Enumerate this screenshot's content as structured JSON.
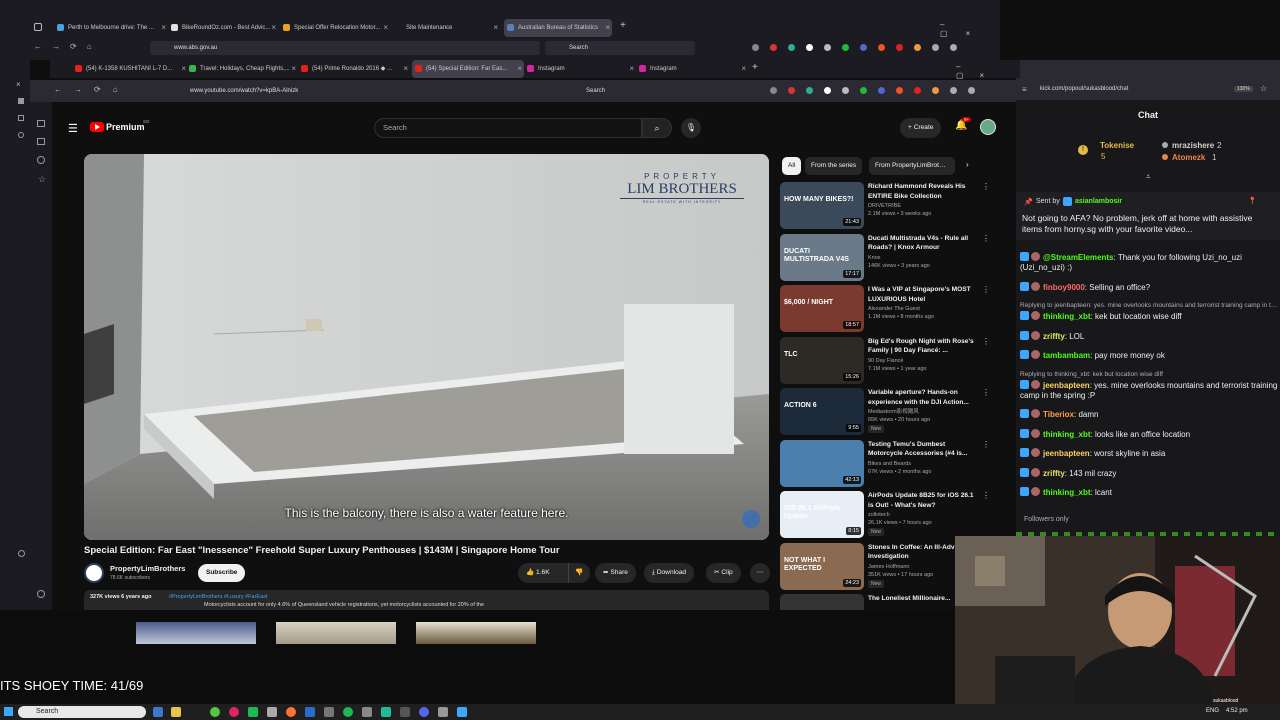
{
  "back_browser": {
    "tabs": [
      {
        "label": "Perth to Melbourne drive: The ...",
        "color": "#4aa3df"
      },
      {
        "label": "BikeRoundOz.com - Best Advic...",
        "color": "#e0e0e0"
      },
      {
        "label": "Special Offer Relocation Motor...",
        "color": "#e8a21c"
      },
      {
        "label": "Site Maintenance",
        "color": "#888888"
      },
      {
        "label": "Australian Bureau of Statistics",
        "color": "#5b7fb8"
      }
    ],
    "url": "www.abs.gov.au",
    "search_placeholder": "Search"
  },
  "front_browser": {
    "tabs": [
      {
        "label": "(54) K-1358 KUSHITANI L-7 D...",
        "color": "#e62117"
      },
      {
        "label": "Travel: Holidays, Cheap Flights,...",
        "color": "#3bb34a"
      },
      {
        "label": "(54) Prime Ronaldo 2016 ◆ ...",
        "color": "#e62117"
      },
      {
        "label": "(54) Special Edition: Far Eas...",
        "color": "#e62117"
      },
      {
        "label": "Instagram",
        "color": "#d6249f"
      },
      {
        "label": "Instagram",
        "color": "#d6249f"
      }
    ],
    "url": "www.youtube.com/watch?v=kpBA-Alnizk",
    "search_placeholder": "Search"
  },
  "youtube": {
    "logo": "Premium",
    "logo_region": "SG",
    "search_placeholder": "Search",
    "create_label": "Create",
    "notifications_count": "9+",
    "video": {
      "brand_line1": "PROPERTY",
      "brand_line2": "LIM BROTHERS",
      "brand_line3": "REAL ESTATE WITH INTEGRITY",
      "caption": "This is the balcony, there is also a water feature here.",
      "title": "Special Edition: Far East \"Inessence\" Freehold Super Luxury Penthouses | $143M | Singapore Home Tour",
      "channel": "PropertyLimBrothers",
      "subscribers": "78.6K subscribers",
      "subscribe_label": "Subscribe",
      "likes": "1.6K",
      "share_label": "Share",
      "download_label": "Download",
      "clip_label": "Clip",
      "views_line": "327K views  6 years ago",
      "hashtags": "#PropertyLimBrothers #Luxury #FarEast",
      "overlay_text": "Motorcyclists account for only 4.6% of Queensland vehicle registrations, yet motorcyclists accounted for 20% of the"
    },
    "chips": [
      "All",
      "From the series",
      "From PropertyLimBrothe..."
    ],
    "recommendations": [
      {
        "title": "Richard Hammond Reveals His ENTIRE Bike Collection",
        "channel": "DRIVETRIBE",
        "meta": "2.1M views • 3 weeks ago",
        "duration": "21:43",
        "thumb_text": "HOW MANY BIKES?!",
        "thumb_color": "#3a4a5a",
        "new": ""
      },
      {
        "title": "Ducati Multistrada V4s - Rule all Roads? | Knox Armour",
        "channel": "Knox",
        "meta": "146K views • 3 years ago",
        "duration": "17:17",
        "thumb_text": "DUCATI MULTISTRADA V4S",
        "thumb_color": "#6b7a88",
        "new": ""
      },
      {
        "title": "I Was a VIP at Singapore's MOST LUXURIOUS Hotel",
        "channel": "Alexander The Guest",
        "meta": "1.1M views • 8 months ago",
        "duration": "18:57",
        "thumb_text": "$6,000 / NIGHT",
        "thumb_color": "#7a3a30",
        "new": ""
      },
      {
        "title": "Big Ed's Rough Night with Rose's Family | 90 Day Fiancé: ...",
        "channel": "90 Day Fiancé",
        "meta": "7.1M views • 1 year ago",
        "duration": "15:26",
        "thumb_text": "TLC",
        "thumb_color": "#2d2a26",
        "new": ""
      },
      {
        "title": "Variable aperture? Hands-on experience with the DJI Action...",
        "channel": "Mediastorm影视飓风",
        "meta": "65K views • 20 hours ago",
        "duration": "9:55",
        "thumb_text": "ACTION 6",
        "thumb_color": "#1c2a3a",
        "new": "New"
      },
      {
        "title": "Testing Temu's Dumbest Motorcycle Accessories (#4 is...",
        "channel": "Bikes and Beards",
        "meta": "67K views • 2 months ago",
        "duration": "42:13",
        "thumb_text": "",
        "thumb_color": "#4a7fae",
        "new": ""
      },
      {
        "title": "AirPods Update 8B25 for iOS 26.1 is Out! - What's New?",
        "channel": "zollotech",
        "meta": "26.1K views • 7 hours ago",
        "duration": "8:15",
        "thumb_text": "iOS 26.1 AirPods Update",
        "thumb_color": "#e8eef6",
        "new": "New"
      },
      {
        "title": "Stones In Coffee: An Ill-Advised Investigation",
        "channel": "James Hoffmann",
        "meta": "351K views • 17 hours ago",
        "duration": "24:23",
        "thumb_text": "NOT WHAT I EXPECTED",
        "thumb_color": "#8a6a50",
        "new": "New"
      },
      {
        "title": "The Loneliest Millionaire...",
        "channel": "",
        "meta": "",
        "duration": "",
        "thumb_text": "",
        "thumb_color": "#333333",
        "new": ""
      }
    ]
  },
  "chat": {
    "url": "kick.com/popout/sukasblood/chat",
    "zoom": "130%",
    "title": "Chat",
    "leaderboard": [
      {
        "name": "Tokenise",
        "value": "5",
        "color": "#e8b94a"
      },
      {
        "name": "mrazishere",
        "value": "2",
        "color": "#d0d0d0"
      },
      {
        "name": "Atomezk",
        "value": "1",
        "color": "#e8864a"
      }
    ],
    "pinned_sender": "asianlambosir",
    "pinned_sent_by": "Sent by",
    "pinned_text": "Not going to AFA? No problem, jerk off at home with assistive items from horny.sg with your favorite video...",
    "messages": [
      {
        "user": "@StreamElements",
        "text": "Thank you for following Uzi_no_uzi (Uzi_no_uzi) :)",
        "color": "#53fc18",
        "reply": ""
      },
      {
        "user": "finboy9000",
        "text": "Selling an office?",
        "color": "#ff6b6b",
        "reply": ""
      },
      {
        "user": "thinking_xbt",
        "text": "kek but location wise diff",
        "color": "#53fc18",
        "reply": "Replying to jeenbapteen: yes. mine overlooks mountains and terrorist training camp in the spring :P"
      },
      {
        "user": "zriffty",
        "text": "LOL",
        "color": "#e6e65c",
        "reply": ""
      },
      {
        "user": "tambambam",
        "text": "pay more money ok",
        "color": "#53fc18",
        "reply": ""
      },
      {
        "user": "jeenbapteen",
        "text": "yes. mine overlooks mountains and terrorist training camp in the spring :P",
        "color": "#ffd166",
        "reply": "Replying to thinking_xbt: kek but location wise diff"
      },
      {
        "user": "Tiberiox",
        "text": "damn",
        "color": "#ff9f43",
        "reply": ""
      },
      {
        "user": "thinking_xbt",
        "text": "looks like an office location",
        "color": "#53fc18",
        "reply": ""
      },
      {
        "user": "jeenbapteen",
        "text": "worst skyline in asia",
        "color": "#ffd166",
        "reply": ""
      },
      {
        "user": "zriffty",
        "text": "143 mil crazy",
        "color": "#e6e65c",
        "reply": ""
      },
      {
        "user": "thinking_xbt",
        "text": "lcant",
        "color": "#53fc18",
        "reply": ""
      }
    ],
    "followers_only": "Followers only"
  },
  "stream_overlay": {
    "counter_text": "ITS SHOEY TIME: 41/69",
    "streamer_handle": "sukasblood"
  },
  "taskbar": {
    "search_placeholder": "Search",
    "lang": "ENG",
    "time": "4:52 pm"
  }
}
